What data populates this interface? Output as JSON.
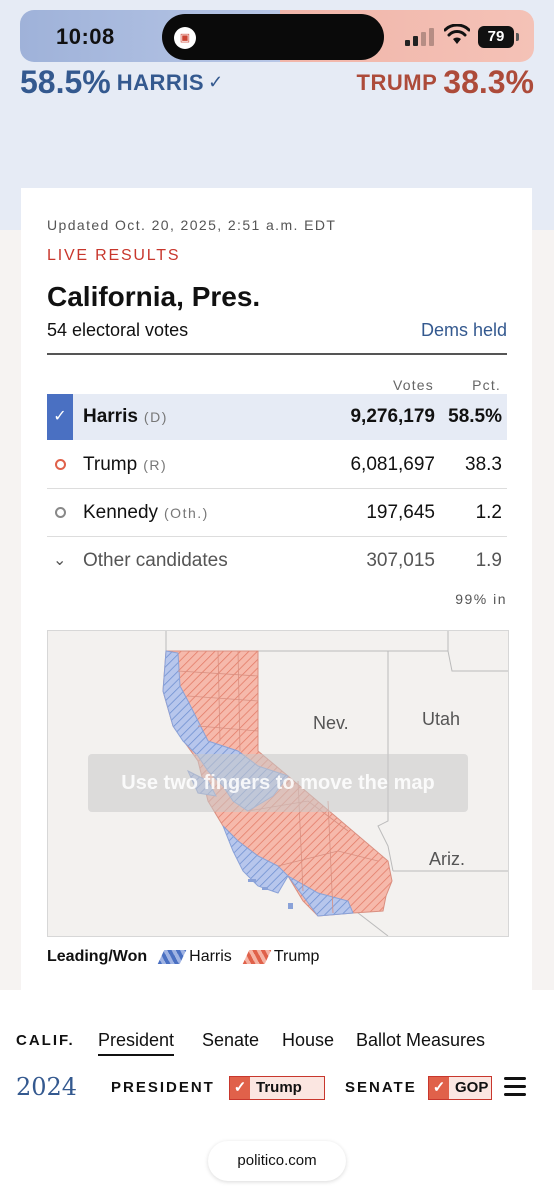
{
  "status_bar": {
    "time": "10:08",
    "battery": "79"
  },
  "header": {
    "left_pct": "58.5%",
    "left_name": "HARRIS",
    "left_check": "✓",
    "right_name": "TRUMP",
    "right_pct": "38.3%"
  },
  "card": {
    "updated": "Updated Oct. 20, 2025, 2:51 a.m. EDT",
    "live": "LIVE RESULTS",
    "title": "California, Pres.",
    "electoral_votes": "54 electoral votes",
    "status": "Dems held",
    "columns": {
      "votes": "Votes",
      "pct": "Pct."
    },
    "rows": [
      {
        "name": "Harris",
        "party": "(D)",
        "votes": "9,276,179",
        "pct": "58.5%"
      },
      {
        "name": "Trump",
        "party": "(R)",
        "votes": "6,081,697",
        "pct": "38.3"
      },
      {
        "name": "Kennedy",
        "party": "(Oth.)",
        "votes": "197,645",
        "pct": "1.2"
      },
      {
        "name": "Other candidates",
        "party": "",
        "votes": "307,015",
        "pct": "1.9"
      }
    ],
    "reporting": "99% in",
    "map": {
      "labels": {
        "nev": "Nev.",
        "utah": "Utah",
        "ariz": "Ariz."
      },
      "overlay": "Use two fingers to move the map"
    },
    "legend": {
      "label": "Leading/Won",
      "harris": "Harris",
      "trump": "Trump"
    }
  },
  "nav": {
    "state": "CALIF.",
    "tabs": [
      "President",
      "Senate",
      "House",
      "Ballot Measures"
    ]
  },
  "ticker": {
    "year": "2024",
    "president_label": "PRESIDENT",
    "president_value": "Trump",
    "senate_label": "SENATE",
    "senate_value": "GOP"
  },
  "browser": {
    "url": "politico.com"
  },
  "colors": {
    "dem": "#4a70c2",
    "gop": "#e0614a",
    "accent_red": "#c8372d",
    "dem_text": "#34598f"
  }
}
